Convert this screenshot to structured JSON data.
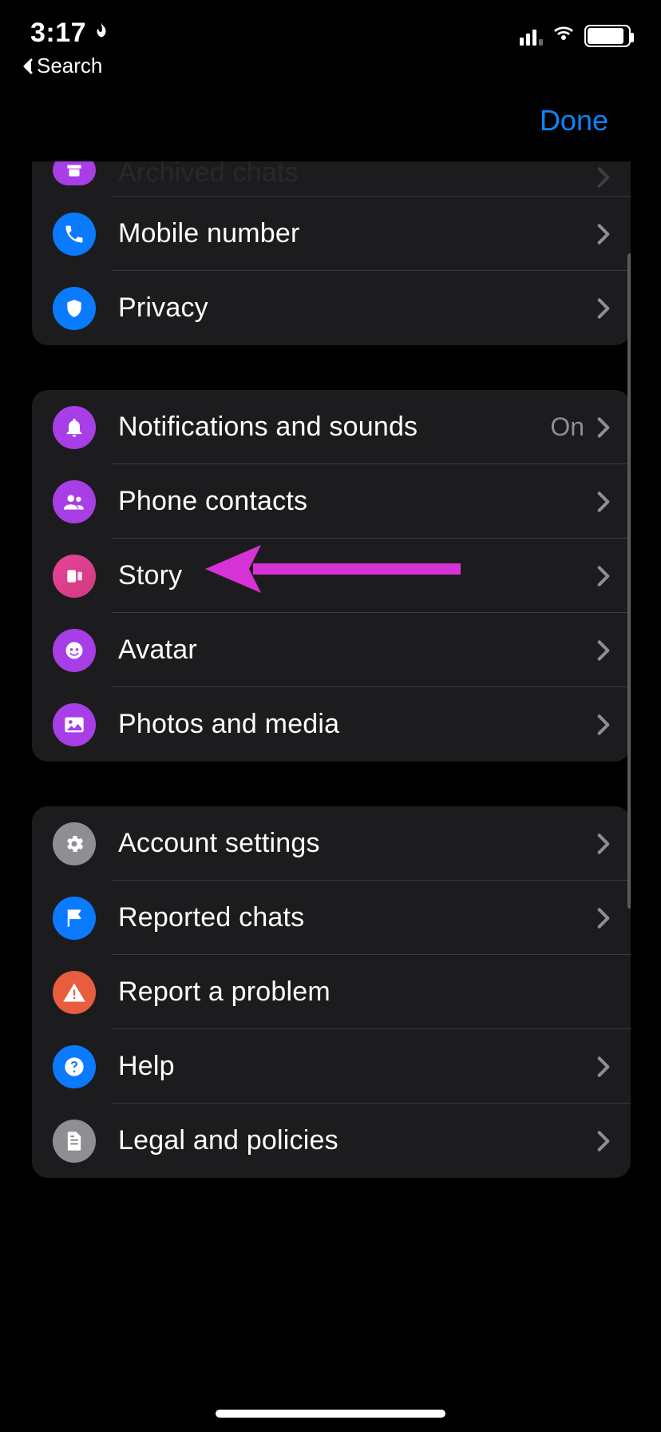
{
  "status": {
    "time": "3:17",
    "back_label": "Search"
  },
  "header": {
    "done": "Done"
  },
  "group1": {
    "items": [
      {
        "label": "Archived chats"
      },
      {
        "label": "Mobile number"
      },
      {
        "label": "Privacy"
      }
    ]
  },
  "group2": {
    "items": [
      {
        "label": "Notifications and sounds",
        "value": "On"
      },
      {
        "label": "Phone contacts"
      },
      {
        "label": "Story"
      },
      {
        "label": "Avatar"
      },
      {
        "label": "Photos and media"
      }
    ]
  },
  "group3": {
    "items": [
      {
        "label": "Account settings"
      },
      {
        "label": "Reported chats"
      },
      {
        "label": "Report a problem"
      },
      {
        "label": "Help"
      },
      {
        "label": "Legal and policies"
      }
    ]
  }
}
